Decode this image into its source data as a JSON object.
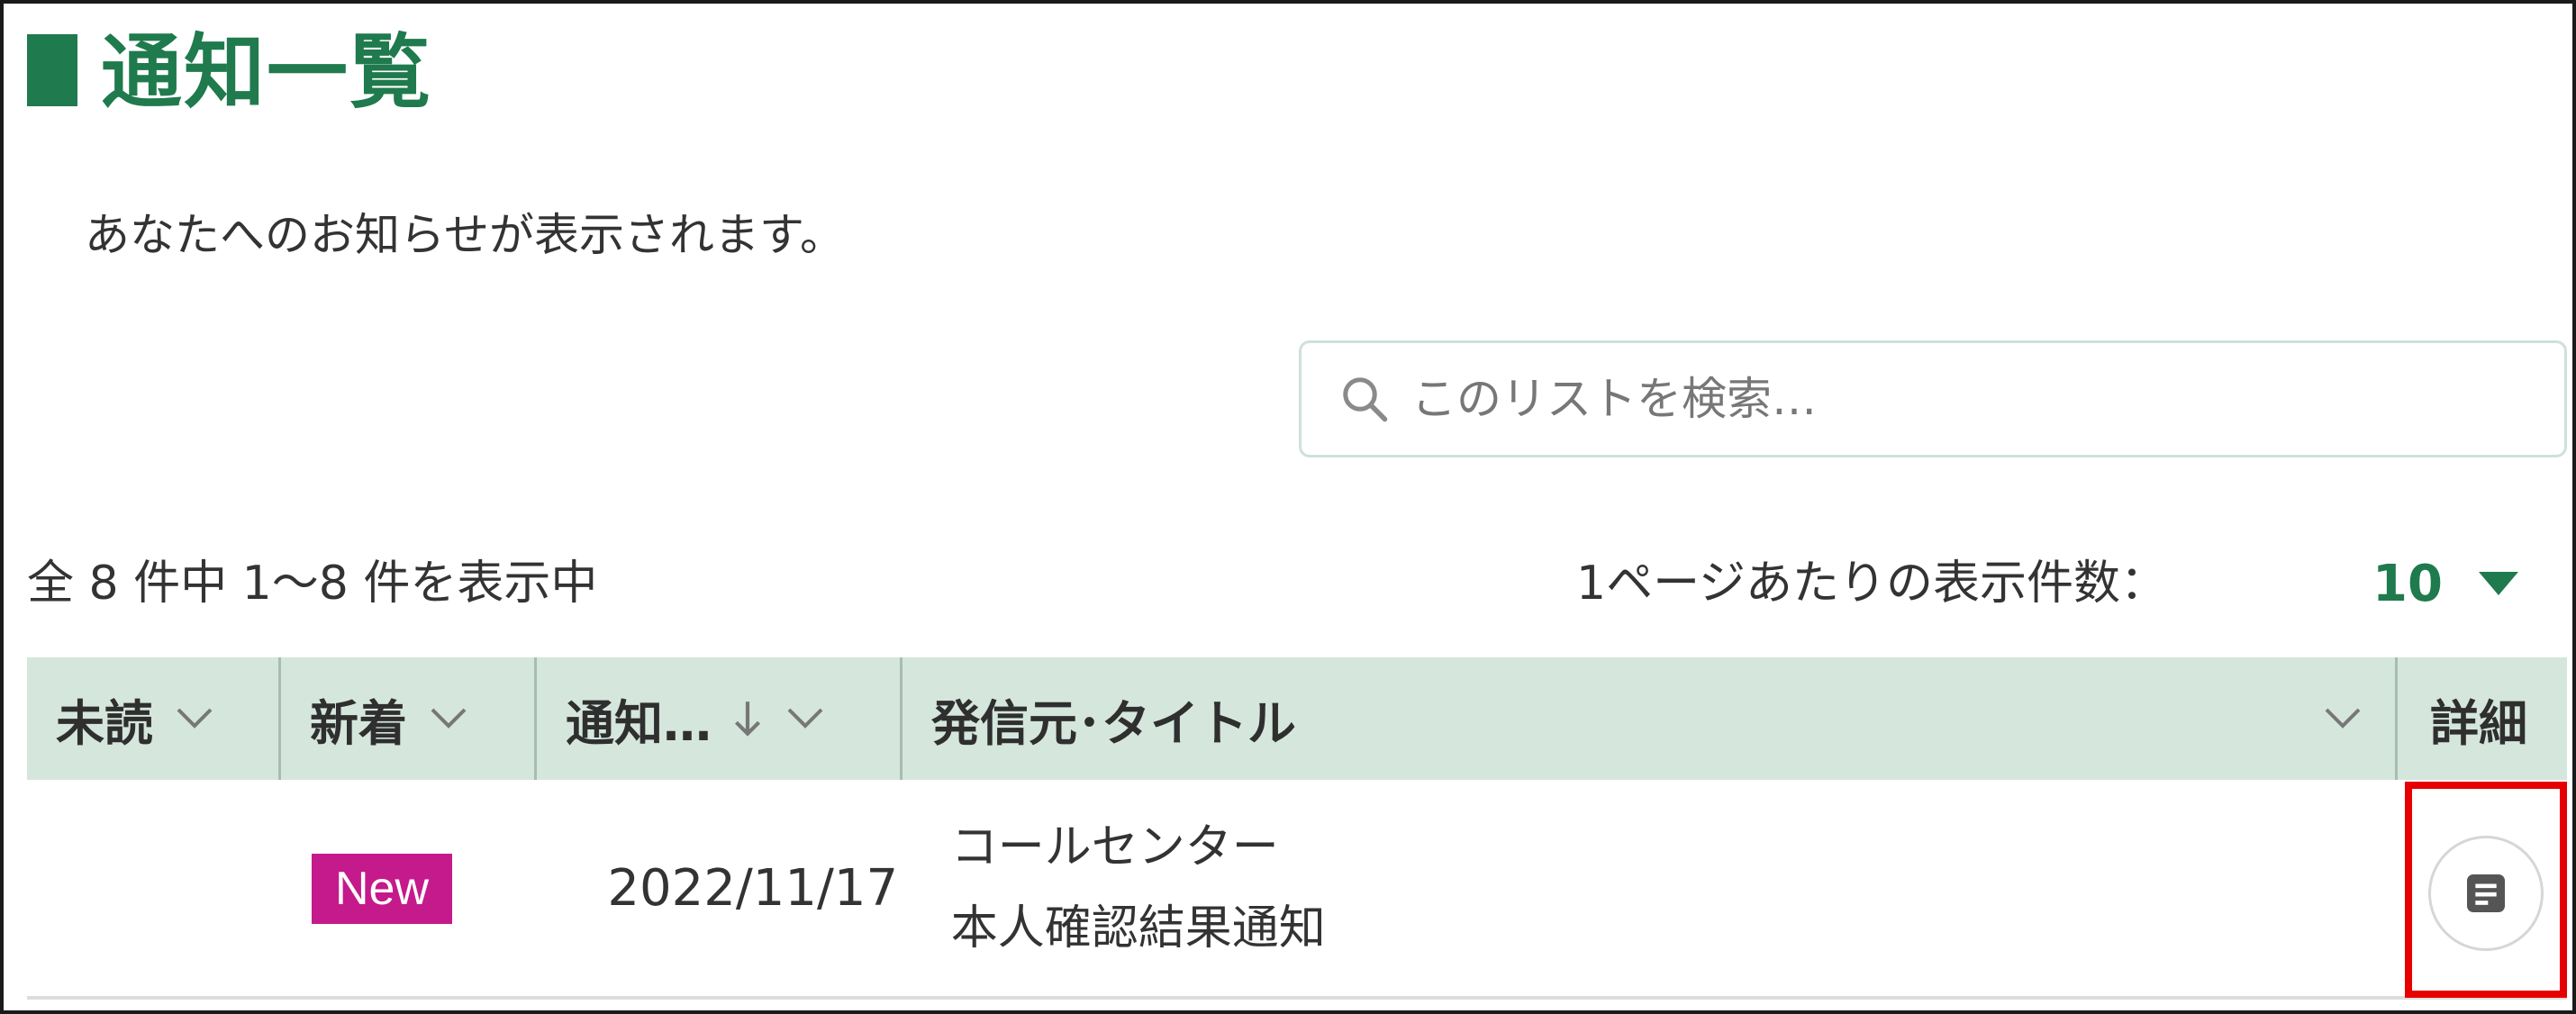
{
  "page": {
    "title": "通知一覧",
    "description": "あなたへのお知らせが表示されます。"
  },
  "search": {
    "placeholder": "このリストを検索…",
    "icon": "search-icon"
  },
  "listing": {
    "count_text": "全 8 件中 1～8 件を表示中",
    "per_page_label": "1ページあたりの表示件数：",
    "per_page_value": "10"
  },
  "table": {
    "columns": {
      "unread": "未読",
      "new": "新着",
      "date": "通知…",
      "sender_title": "発信元･タイトル",
      "detail": "詳細"
    },
    "sort": {
      "column": "date",
      "direction": "descending"
    },
    "rows": [
      {
        "unread": "",
        "new_badge": "New",
        "date": "2022/11/17",
        "sender": "コールセンター",
        "title": "本人確認結果通知",
        "detail_icon": "document-icon"
      }
    ]
  },
  "colors": {
    "brand_green": "#1f7a4d",
    "header_bg": "#d5e6dd",
    "new_badge": "#c41a8b",
    "highlight": "#e60000"
  }
}
